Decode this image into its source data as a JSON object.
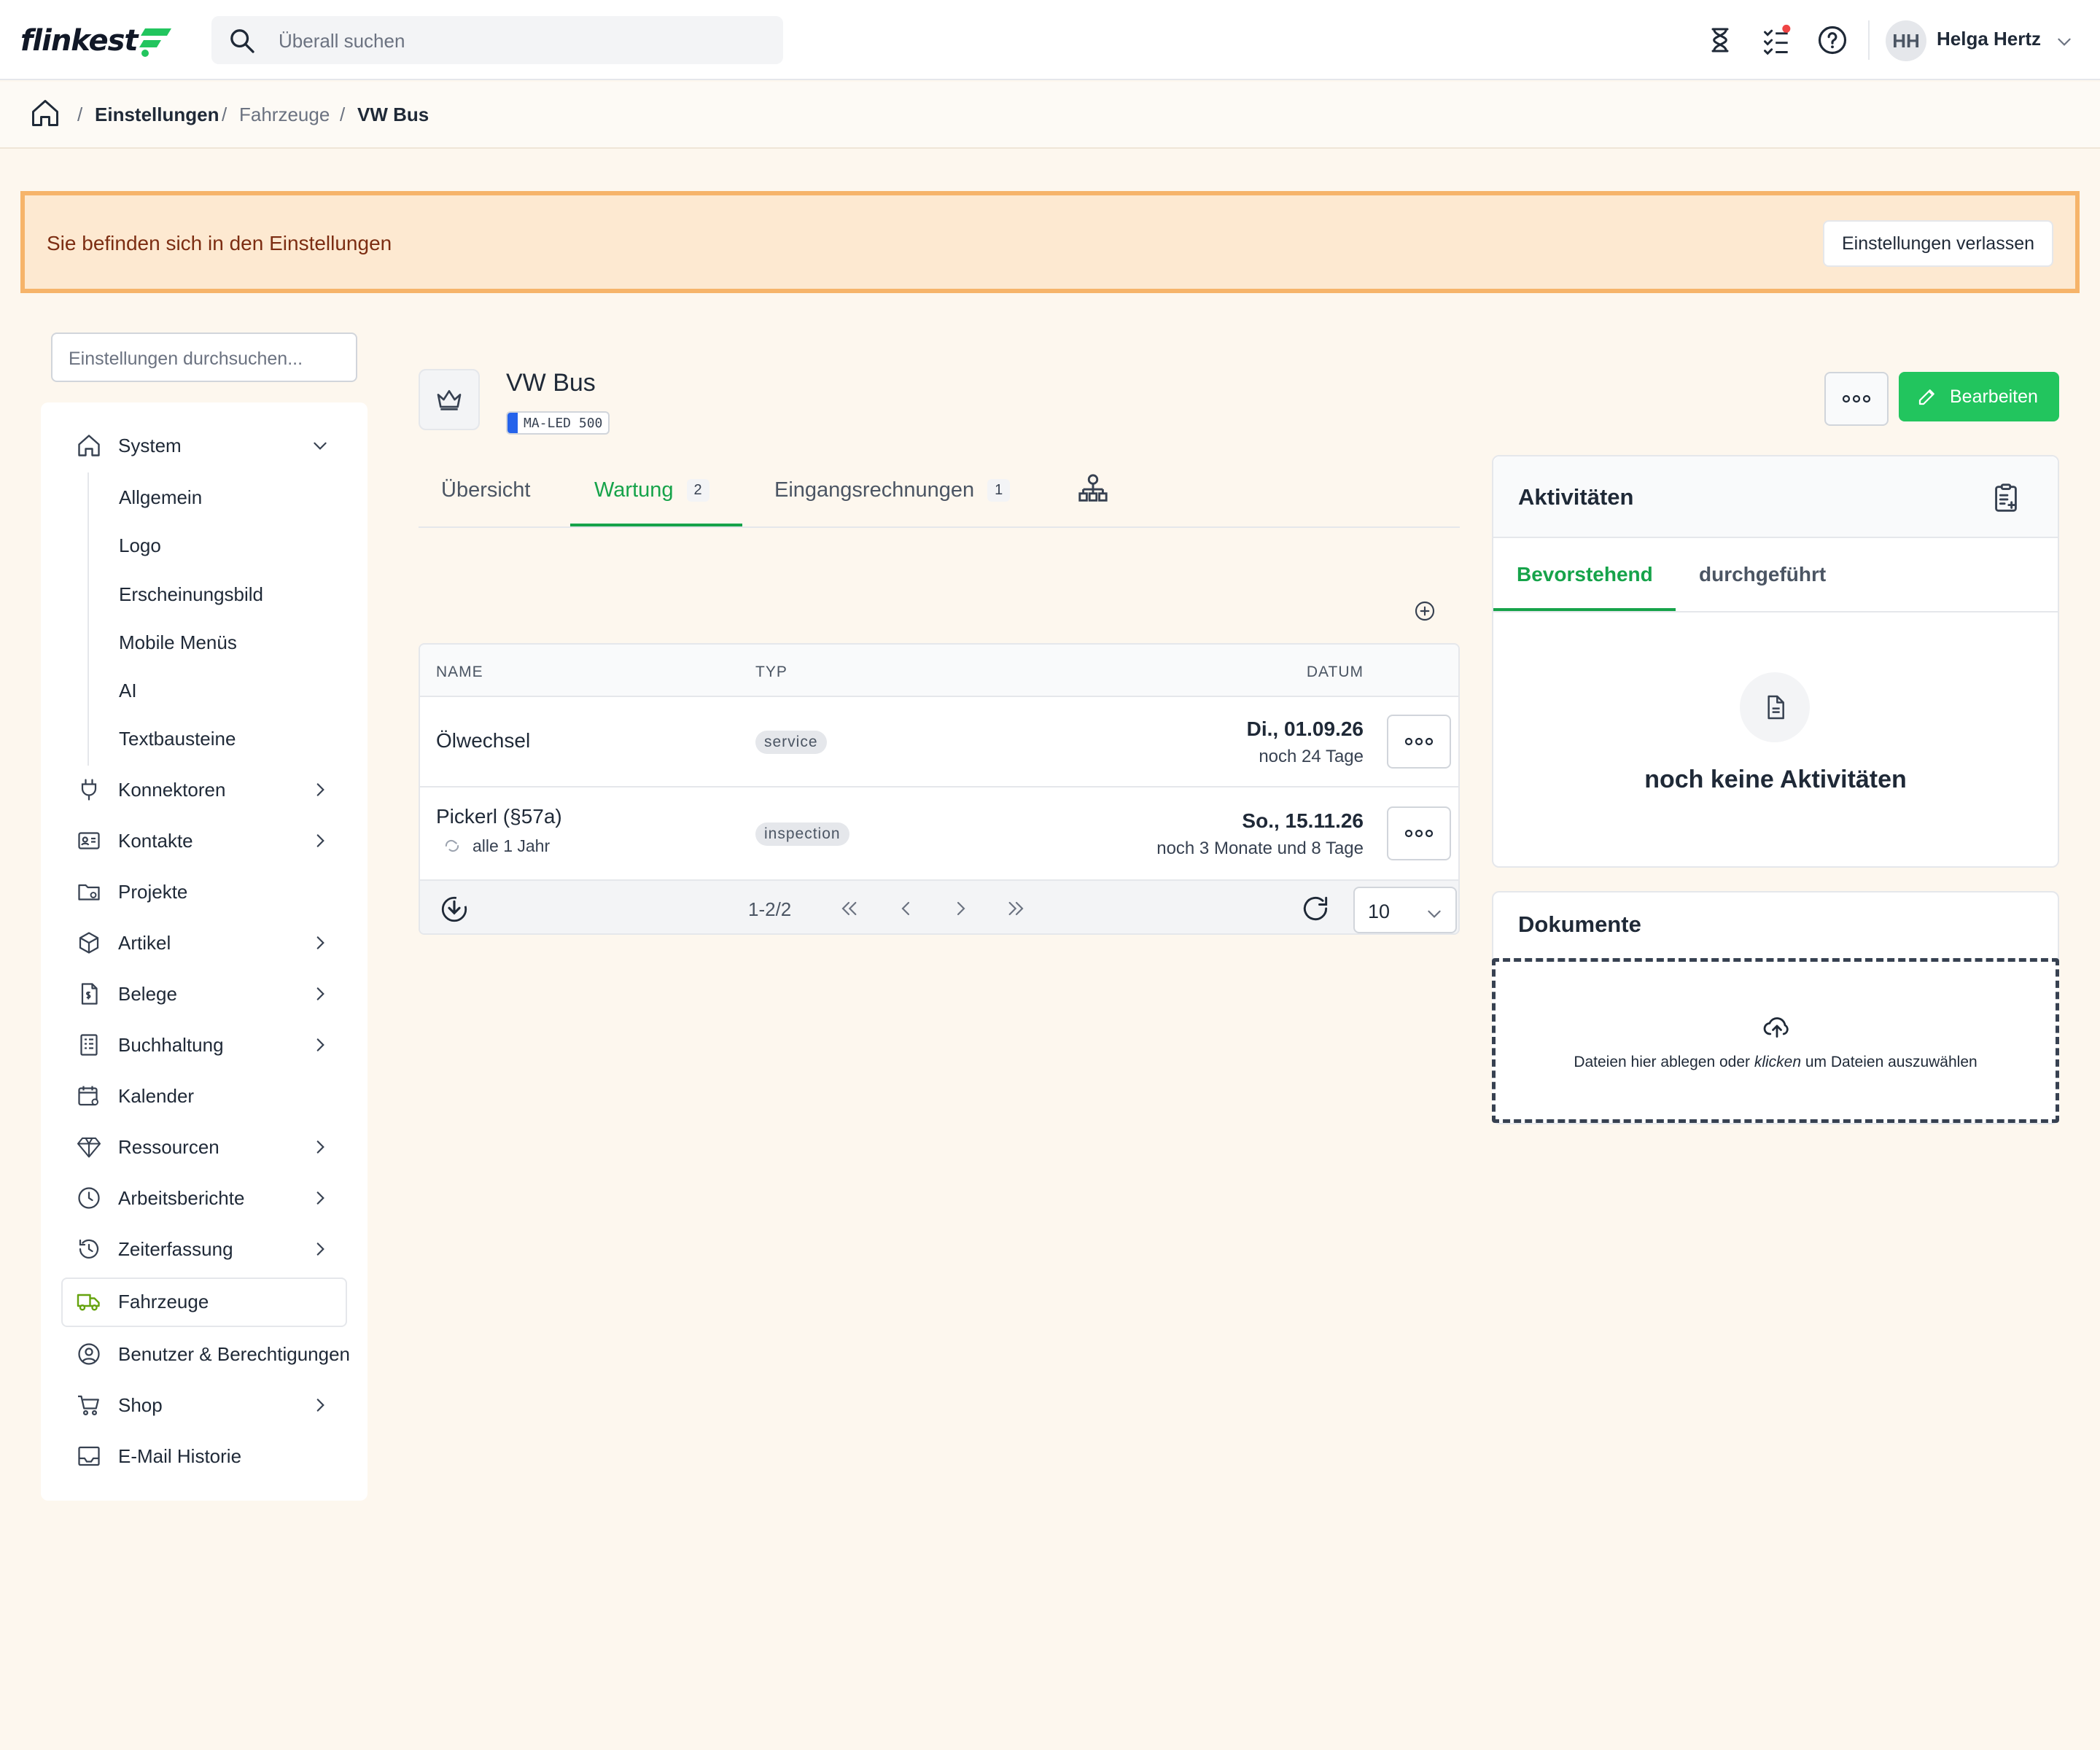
{
  "app": {
    "logo_text": "flinkest",
    "search_placeholder": "Überall suchen",
    "user": {
      "initials": "HH",
      "name": "Helga Hertz"
    },
    "brand_color": "#22c55e",
    "notification_color": "#ef4444"
  },
  "breadcrumb": {
    "items": [
      "Einstellungen",
      "Fahrzeuge",
      "VW Bus"
    ],
    "separator": "/"
  },
  "banner": {
    "text": "Sie befinden sich in den Einstellungen",
    "button": "Einstellungen verlassen"
  },
  "sidebar": {
    "search_placeholder": "Einstellungen durchsuchen...",
    "system_label": "System",
    "system_subitems": [
      "Allgemein",
      "Logo",
      "Erscheinungsbild",
      "Mobile Menüs",
      "AI",
      "Textbausteine"
    ],
    "items": [
      {
        "label": "Konnektoren",
        "icon": "plug-icon",
        "has_children": true
      },
      {
        "label": "Kontakte",
        "icon": "contact-card-icon",
        "has_children": true
      },
      {
        "label": "Projekte",
        "icon": "folder-gear-icon",
        "has_children": false
      },
      {
        "label": "Artikel",
        "icon": "box-icon",
        "has_children": true
      },
      {
        "label": "Belege",
        "icon": "receipt-icon",
        "has_children": true
      },
      {
        "label": "Buchhaltung",
        "icon": "ledger-icon",
        "has_children": true
      },
      {
        "label": "Kalender",
        "icon": "calendar-gear-icon",
        "has_children": false
      },
      {
        "label": "Ressourcen",
        "icon": "diamond-icon",
        "has_children": true
      },
      {
        "label": "Arbeitsberichte",
        "icon": "clock-icon",
        "has_children": true
      },
      {
        "label": "Zeiterfassung",
        "icon": "history-icon",
        "has_children": true
      },
      {
        "label": "Fahrzeuge",
        "icon": "truck-icon",
        "has_children": false,
        "active": true
      },
      {
        "label": "Benutzer & Berechtigungen",
        "icon": "user-circle-icon",
        "has_children": false
      },
      {
        "label": "Shop",
        "icon": "cart-icon",
        "has_children": true
      },
      {
        "label": "E-Mail Historie",
        "icon": "inbox-icon",
        "has_children": false
      }
    ]
  },
  "vehicle": {
    "title": "VW Bus",
    "plate": "MA-LED 500",
    "edit_label": "Bearbeiten"
  },
  "tabs": [
    {
      "label": "Übersicht",
      "count": ""
    },
    {
      "label": "Wartung",
      "count": "2",
      "active": true
    },
    {
      "label": "Eingangsrechnungen",
      "count": "1"
    }
  ],
  "table": {
    "headers": {
      "name": "NAME",
      "type": "TYP",
      "date": "DATUM"
    },
    "rows": [
      {
        "name": "Ölwechsel",
        "repeat": "",
        "type": "service",
        "date": "Di., 01.09.26",
        "remaining": "noch 24 Tage"
      },
      {
        "name": "Pickerl (§57a)",
        "repeat": "alle 1 Jahr",
        "type": "inspection",
        "date": "So., 15.11.26",
        "remaining": "noch 3 Monate und 8 Tage"
      }
    ],
    "pager": {
      "range": "1-2/2",
      "per_page": "10"
    }
  },
  "activities": {
    "title": "Aktivitäten",
    "tabs": [
      "Bevorstehend",
      "durchgeführt"
    ],
    "empty": "noch keine Aktivitäten"
  },
  "documents": {
    "title": "Dokumente",
    "drop_before": "Dateien hier ablegen oder ",
    "drop_em": "klicken",
    "drop_after": " um Dateien auszuwählen"
  }
}
